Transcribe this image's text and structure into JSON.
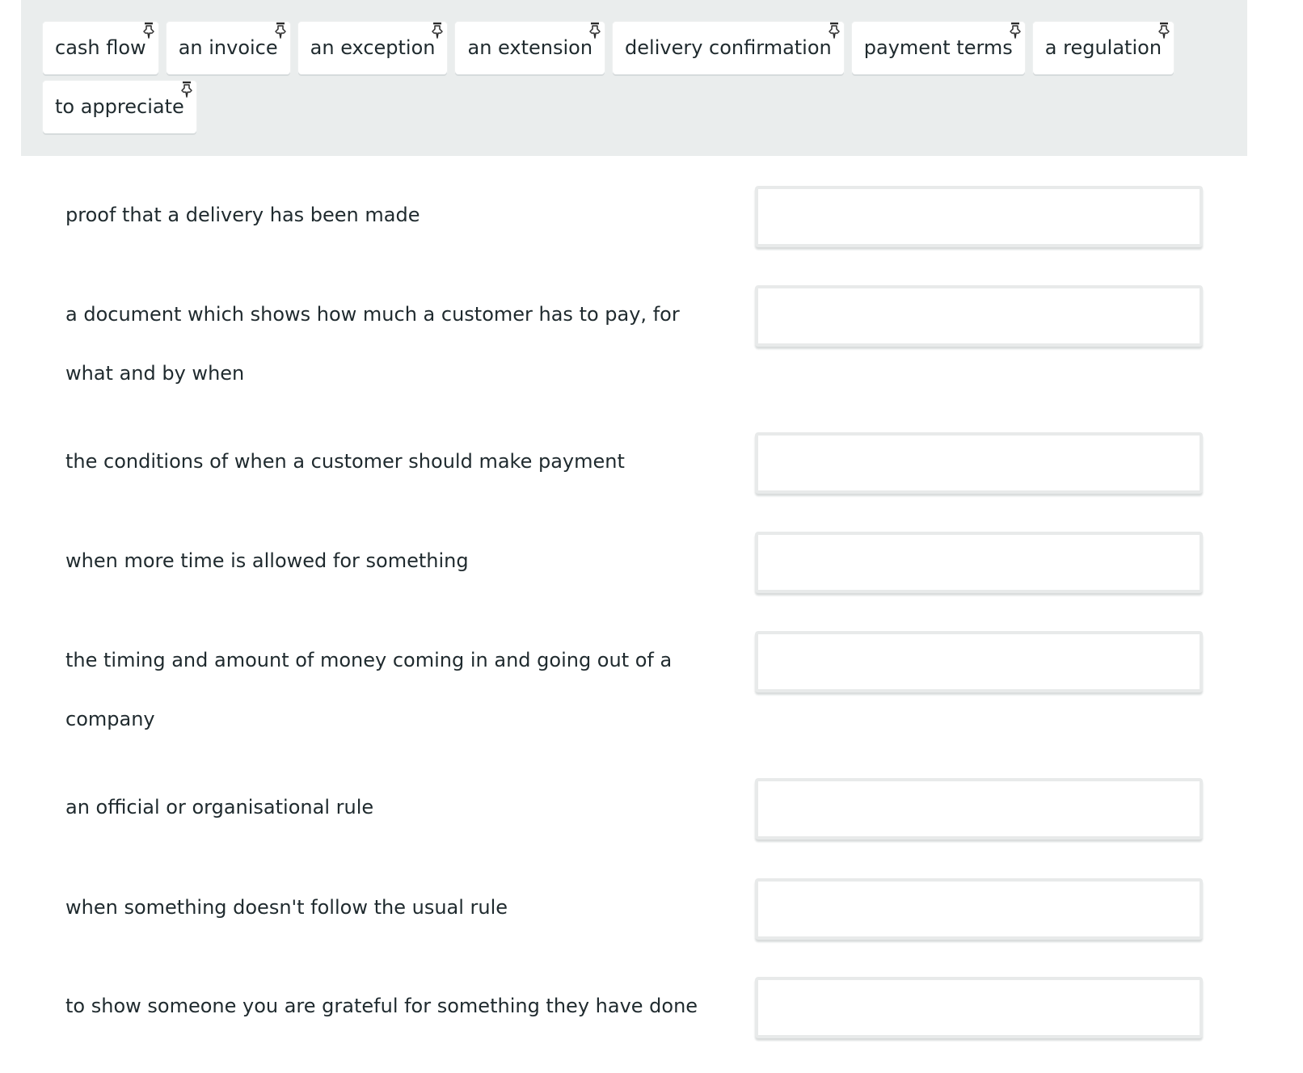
{
  "word_pool": {
    "chips": [
      {
        "label": "cash flow",
        "icon": "pin-icon"
      },
      {
        "label": "an invoice",
        "icon": "pin-icon"
      },
      {
        "label": "an exception",
        "icon": "pin-icon"
      },
      {
        "label": "an extension",
        "icon": "pin-icon"
      },
      {
        "label": "delivery confirmation",
        "icon": "pin-icon"
      },
      {
        "label": "payment terms",
        "icon": "pin-icon"
      },
      {
        "label": "a regulation",
        "icon": "pin-icon"
      },
      {
        "label": "to appreciate",
        "icon": "pin-icon"
      }
    ]
  },
  "definitions": [
    {
      "text": "proof that a delivery has been made",
      "answer": ""
    },
    {
      "text": "a document which shows how much a customer has to pay, for what and by when",
      "answer": ""
    },
    {
      "text": "the conditions of when a customer should make payment",
      "answer": ""
    },
    {
      "text": "when more time is allowed for something",
      "answer": ""
    },
    {
      "text": "the timing and amount of money coming in and going out of a company",
      "answer": ""
    },
    {
      "text": "an official or organisational rule",
      "answer": ""
    },
    {
      "text": "when something doesn't follow the usual rule",
      "answer": ""
    },
    {
      "text": "to show someone you are grateful for something they have done",
      "answer": ""
    }
  ],
  "colors": {
    "pool_background": "#eaeded",
    "text": "#1f2a2e",
    "box_border": "#e8eaea"
  }
}
